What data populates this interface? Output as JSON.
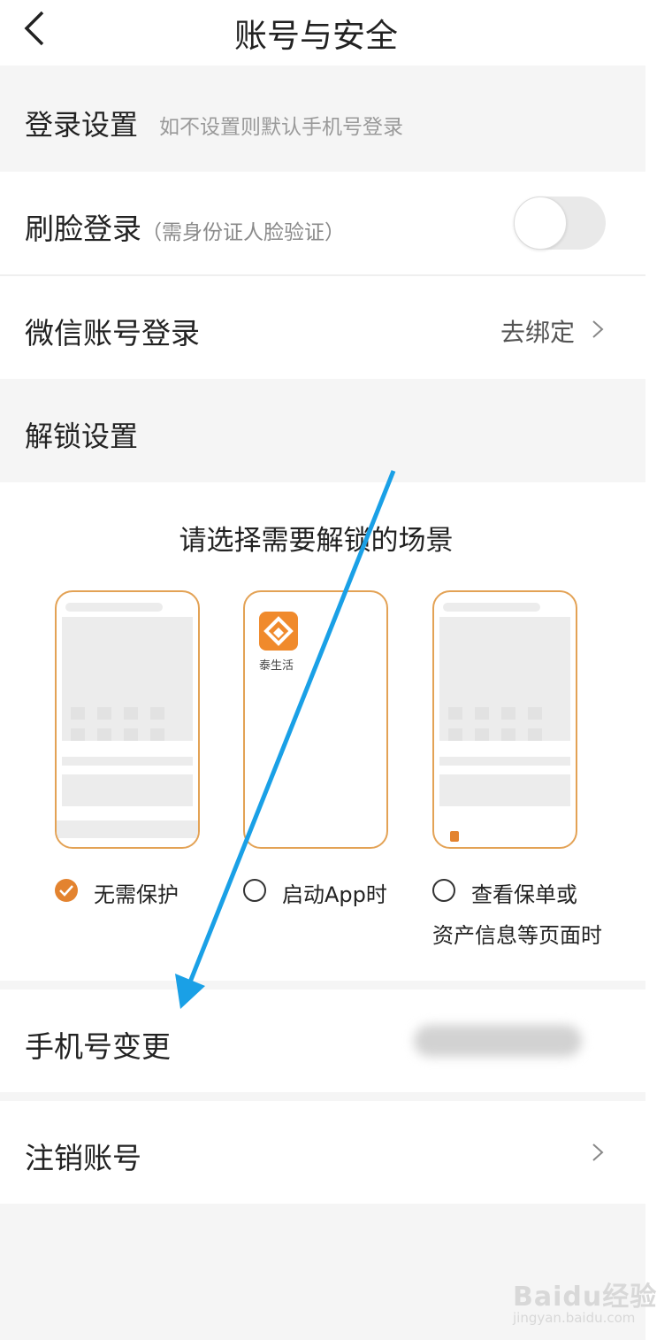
{
  "header": {
    "title": "账号与安全"
  },
  "login_section": {
    "title": "登录设置",
    "hint": "如不设置则默认手机号登录"
  },
  "face_login": {
    "label": "刷脸登录",
    "sub": "（需身份证人脸验证）",
    "enabled": false
  },
  "wechat_login": {
    "label": "微信账号登录",
    "action": "去绑定"
  },
  "unlock_section": {
    "title": "解锁设置",
    "prompt": "请选择需要解锁的场景",
    "app_name": "泰生活",
    "options": [
      {
        "label": "无需保护",
        "checked": true
      },
      {
        "label": "启动App时",
        "checked": false
      },
      {
        "label_line1": "查看保单或",
        "label_line2": "资产信息等页面时",
        "checked": false
      }
    ]
  },
  "phone_change": {
    "label": "手机号变更"
  },
  "cancel_account": {
    "label": "注销账号"
  },
  "watermark": {
    "brand": "Baidu经验",
    "url": "jingyan.baidu.com"
  },
  "colors": {
    "accent": "#e3832f",
    "arrow": "#1aa0e6"
  }
}
